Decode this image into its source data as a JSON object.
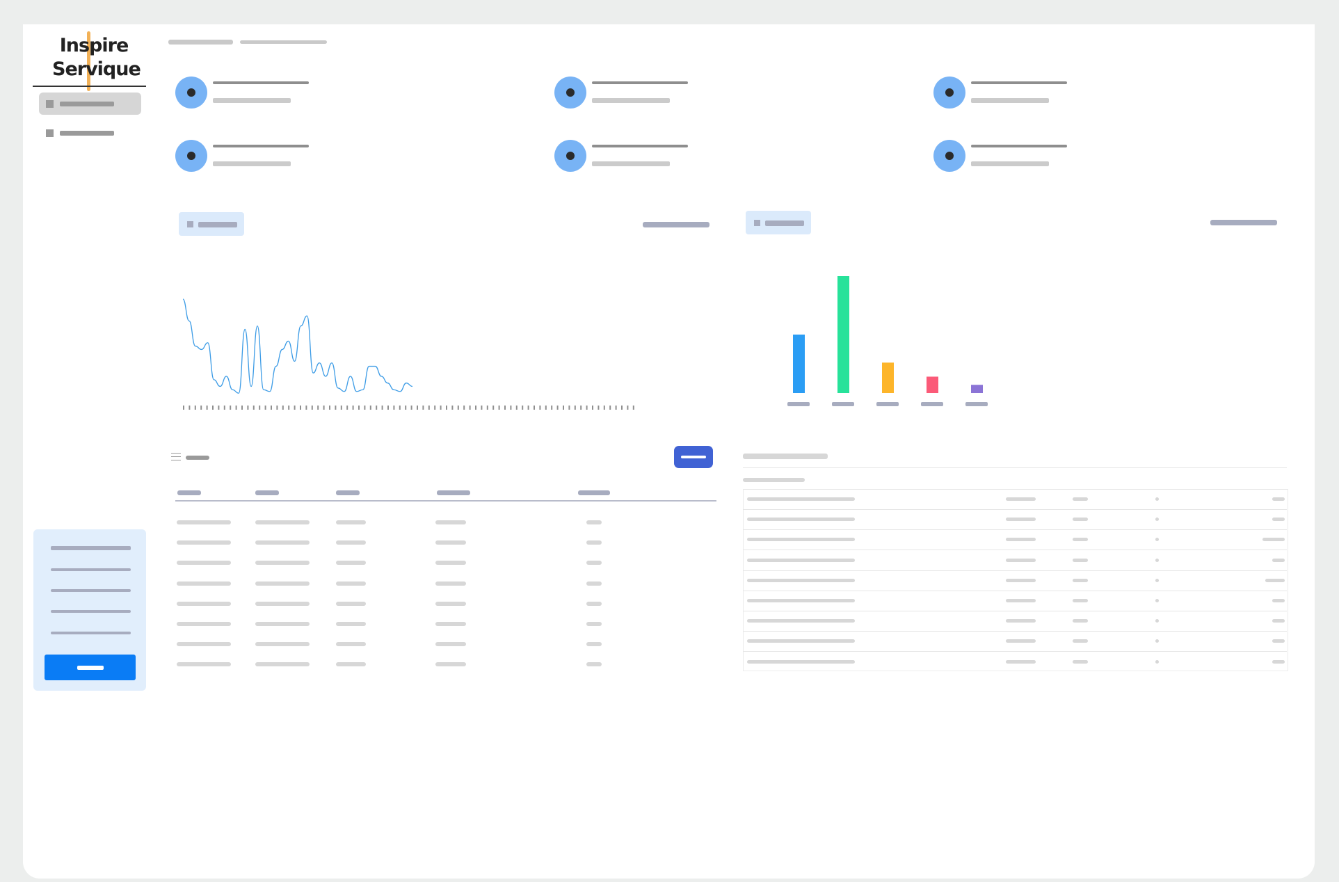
{
  "app": {
    "logo_line1": "Inspire",
    "logo_line2": "Servique"
  },
  "colors": {
    "accent": "#0a7cf5",
    "stat_circle": "#78b3f5",
    "line_stroke": "#3d9ce6",
    "bar_colors": [
      "#2b9df4",
      "#27e29a",
      "#fdb52a",
      "#fb5a78",
      "#8b74d6"
    ]
  },
  "sidebar": {
    "items": [
      {
        "icon": "square-icon",
        "active": true
      },
      {
        "icon": "square-icon",
        "active": false
      }
    ]
  },
  "charts": {
    "bar_chart": {
      "type": "bar",
      "values": [
        100,
        200,
        52,
        28,
        14
      ]
    },
    "line_chart": {
      "type": "line",
      "y": [
        58,
        45,
        30,
        28,
        32,
        10,
        6,
        12,
        4,
        2,
        40,
        6,
        42,
        4,
        3,
        18,
        28,
        33,
        21,
        42,
        48,
        14,
        20,
        12,
        20,
        5,
        3,
        12,
        3,
        4,
        18,
        18,
        12,
        8,
        4,
        3,
        8,
        6
      ]
    }
  },
  "table_left": {
    "rows": 8
  },
  "table_right": {
    "rows": 9
  }
}
